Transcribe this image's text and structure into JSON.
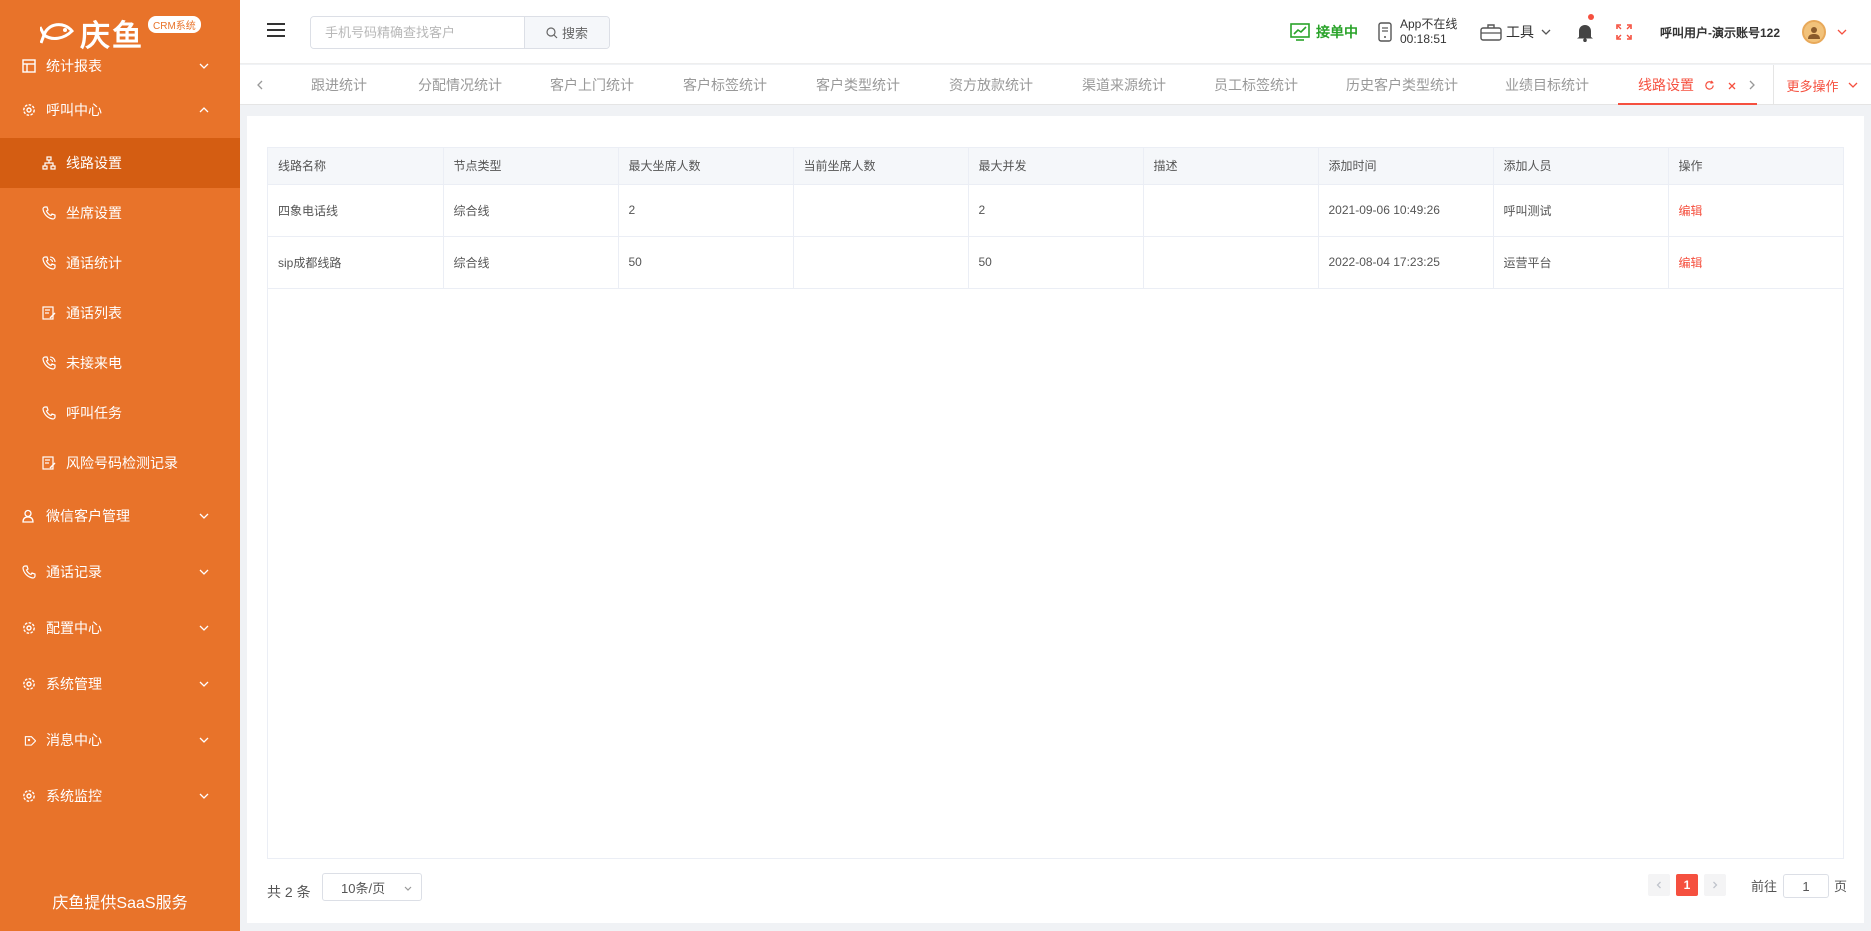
{
  "brand": {
    "logo_text": "庆鱼",
    "badge": "CRM系统",
    "footer": "庆鱼提供SaaS服务",
    "accent_color": "#e8732a",
    "active_color": "#f5503f"
  },
  "sidebar": {
    "groups": [
      {
        "label": "统计报表",
        "icon": "chart-grid-icon"
      },
      {
        "label": "呼叫中心",
        "icon": "gear-icon",
        "expanded": true
      },
      {
        "label": "微信客户管理",
        "icon": "user-icon"
      },
      {
        "label": "通话记录",
        "icon": "phone-icon"
      },
      {
        "label": "配置中心",
        "icon": "gear-icon"
      },
      {
        "label": "系统管理",
        "icon": "gear-icon"
      },
      {
        "label": "消息中心",
        "icon": "tag-icon"
      },
      {
        "label": "系统监控",
        "icon": "gear-icon"
      }
    ],
    "sub_items": [
      {
        "label": "线路设置",
        "icon": "network-icon",
        "active": true
      },
      {
        "label": "坐席设置",
        "icon": "phone-icon"
      },
      {
        "label": "通话统计",
        "icon": "phone-call-icon"
      },
      {
        "label": "通话列表",
        "icon": "edit-list-icon"
      },
      {
        "label": "未接来电",
        "icon": "phone-call-icon"
      },
      {
        "label": "呼叫任务",
        "icon": "phone-icon"
      },
      {
        "label": "风险号码检测记录",
        "icon": "edit-list-icon"
      }
    ]
  },
  "header": {
    "search_placeholder": "手机号码精确查找客户",
    "search_button": "搜索",
    "status": "接单中",
    "app_status": "App不在线",
    "app_timer": "00:18:51",
    "tools": "工具",
    "user": "呼叫用户-演示账号122"
  },
  "tabs": {
    "items": [
      "跟进统计",
      "分配情况统计",
      "客户上门统计",
      "客户标签统计",
      "客户类型统计",
      "资方放款统计",
      "渠道来源统计",
      "员工标签统计",
      "历史客户类型统计",
      "业绩目标统计"
    ],
    "active": "线路设置",
    "more": "更多操作"
  },
  "table": {
    "columns": [
      "线路名称",
      "节点类型",
      "最大坐席人数",
      "当前坐席人数",
      "最大并发",
      "描述",
      "添加时间",
      "添加人员",
      "操作"
    ],
    "rows": [
      {
        "name": "四象电话线",
        "type": "综合线",
        "max_seats": "2",
        "current_seats": "",
        "max_concurrent": "2",
        "desc": "",
        "time": "2021-09-06 10:49:26",
        "creator": "呼叫测试",
        "action": "编辑"
      },
      {
        "name": "sip成都线路",
        "type": "综合线",
        "max_seats": "50",
        "current_seats": "",
        "max_concurrent": "50",
        "desc": "",
        "time": "2022-08-04 17:23:25",
        "creator": "运营平台",
        "action": "编辑"
      }
    ]
  },
  "pager": {
    "total": "共 2 条",
    "page_size": "10条/页",
    "current": "1",
    "goto_prefix": "前往",
    "goto_value": "1",
    "goto_suffix": "页"
  }
}
